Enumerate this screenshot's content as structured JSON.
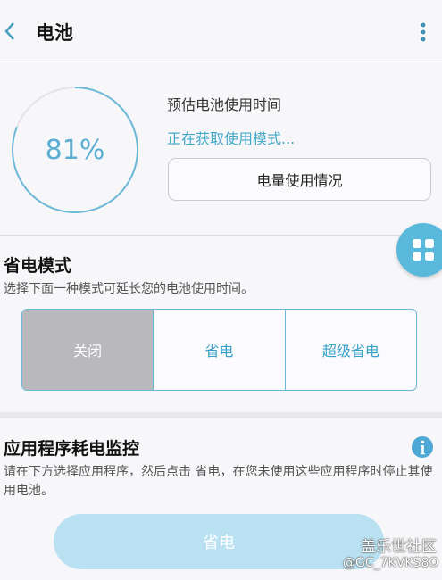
{
  "header": {
    "title": "电池"
  },
  "battery": {
    "percent_label": "81%",
    "level_fraction": 0.81,
    "estimate_label": "预估电池使用时间",
    "status": "正在获取使用模式...",
    "usage_button": "电量使用情况"
  },
  "power_mode": {
    "title": "省电模式",
    "subtitle": "选择下面一种模式可延长您的电池使用时间。",
    "options": [
      "关闭",
      "省电",
      "超级省电"
    ],
    "selected": "关闭"
  },
  "app_monitor": {
    "title": "应用程序耗电监控",
    "description": "请在下方选择应用程序，然后点击 省电，在您未使用这些应用程序时停止其使用电池。",
    "save_button": "省电"
  },
  "watermark": {
    "line1": "盖乐世社区",
    "line2": "@GC_7KVKS8O"
  },
  "icons": {
    "back": "chevron-left-icon",
    "more": "more-vertical-icon",
    "fab": "grid-icon",
    "info": "info-icon"
  },
  "colors": {
    "accent": "#5ab8dc",
    "ring": "#6bb9d6",
    "selected_segment": "#b9b9bd"
  }
}
